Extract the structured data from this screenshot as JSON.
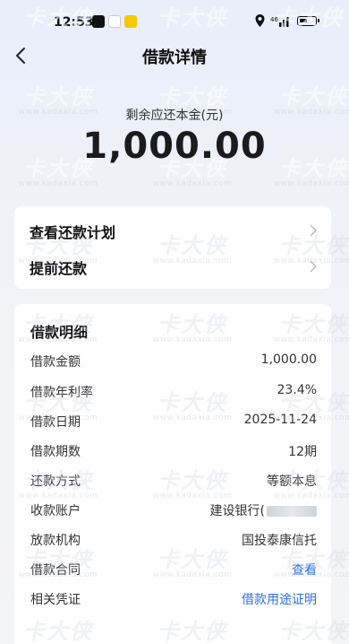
{
  "status_bar": {
    "time": "12:53",
    "network": "⁴⁶ıll"
  },
  "nav": {
    "title": "借款详情",
    "back_icon": "chevron-left-icon"
  },
  "summary": {
    "label": "剩余应还本金(元)",
    "amount": "1,000.00"
  },
  "actions": [
    {
      "label": "查看还款计划",
      "icon": "chevron-right-icon"
    },
    {
      "label": "提前还款",
      "icon": "chevron-right-icon"
    }
  ],
  "details": {
    "title": "借款明细",
    "rows": [
      {
        "label": "借款金额",
        "value": "1,000.00"
      },
      {
        "label": "借款年利率",
        "value": "23.4%"
      },
      {
        "label": "借款日期",
        "value": "2025-11-24"
      },
      {
        "label": "借款期数",
        "value": "12期"
      },
      {
        "label": "还款方式",
        "value": "等额本息"
      },
      {
        "label": "收款账户",
        "value": "建设银行("
      },
      {
        "label": "放款机构",
        "value": "国投泰康信托"
      },
      {
        "label": "借款合同",
        "value": "查看"
      },
      {
        "label": "相关凭证",
        "value": "借款用途证明"
      }
    ]
  },
  "watermark": {
    "brand": "卡大侠",
    "url": "www.kadaxia.com"
  },
  "colors": {
    "link": "#2f6fea",
    "background_top": "#e9eefb",
    "card": "#ffffff"
  }
}
